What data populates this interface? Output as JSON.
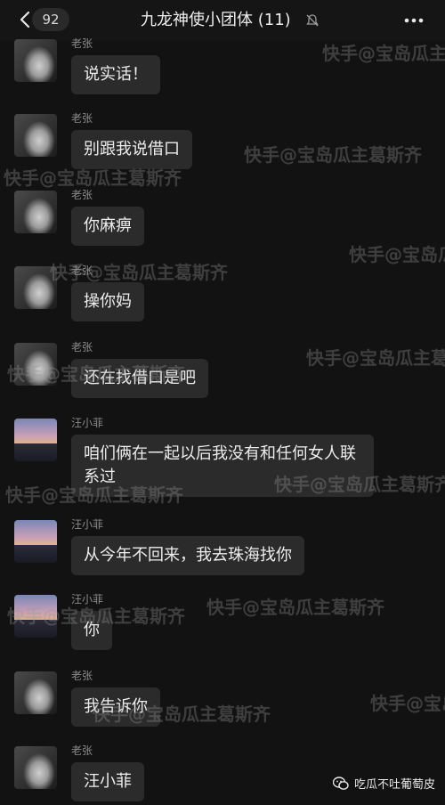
{
  "header": {
    "unread_count": "92",
    "title": "九龙神使小团体 (11)"
  },
  "messages": [
    {
      "sender": "老张",
      "text": "说实话！",
      "avatar": "zhang"
    },
    {
      "sender": "老张",
      "text": "别跟我说借口",
      "avatar": "zhang"
    },
    {
      "sender": "老张",
      "text": "你麻痹",
      "avatar": "zhang"
    },
    {
      "sender": "老张",
      "text": "操你妈",
      "avatar": "zhang"
    },
    {
      "sender": "老张",
      "text": "还在找借口是吧",
      "avatar": "zhang"
    },
    {
      "sender": "汪小菲",
      "text": "咱们俩在一起以后我没有和任何女人联系过",
      "avatar": "wang"
    },
    {
      "sender": "汪小菲",
      "text": "从今年不回来，我去珠海找你",
      "avatar": "wang"
    },
    {
      "sender": "汪小菲",
      "text": "你",
      "avatar": "wang"
    },
    {
      "sender": "老张",
      "text": "我告诉你",
      "avatar": "zhang"
    },
    {
      "sender": "老张",
      "text": "汪小菲",
      "avatar": "zhang"
    }
  ],
  "watermark": "快手@宝岛瓜主葛斯齐",
  "footer": {
    "text": "吃瓜不吐葡萄皮"
  },
  "icons": [
    "back-chevron-icon",
    "mute-bell-icon",
    "more-icon",
    "wechat-logo-icon"
  ]
}
